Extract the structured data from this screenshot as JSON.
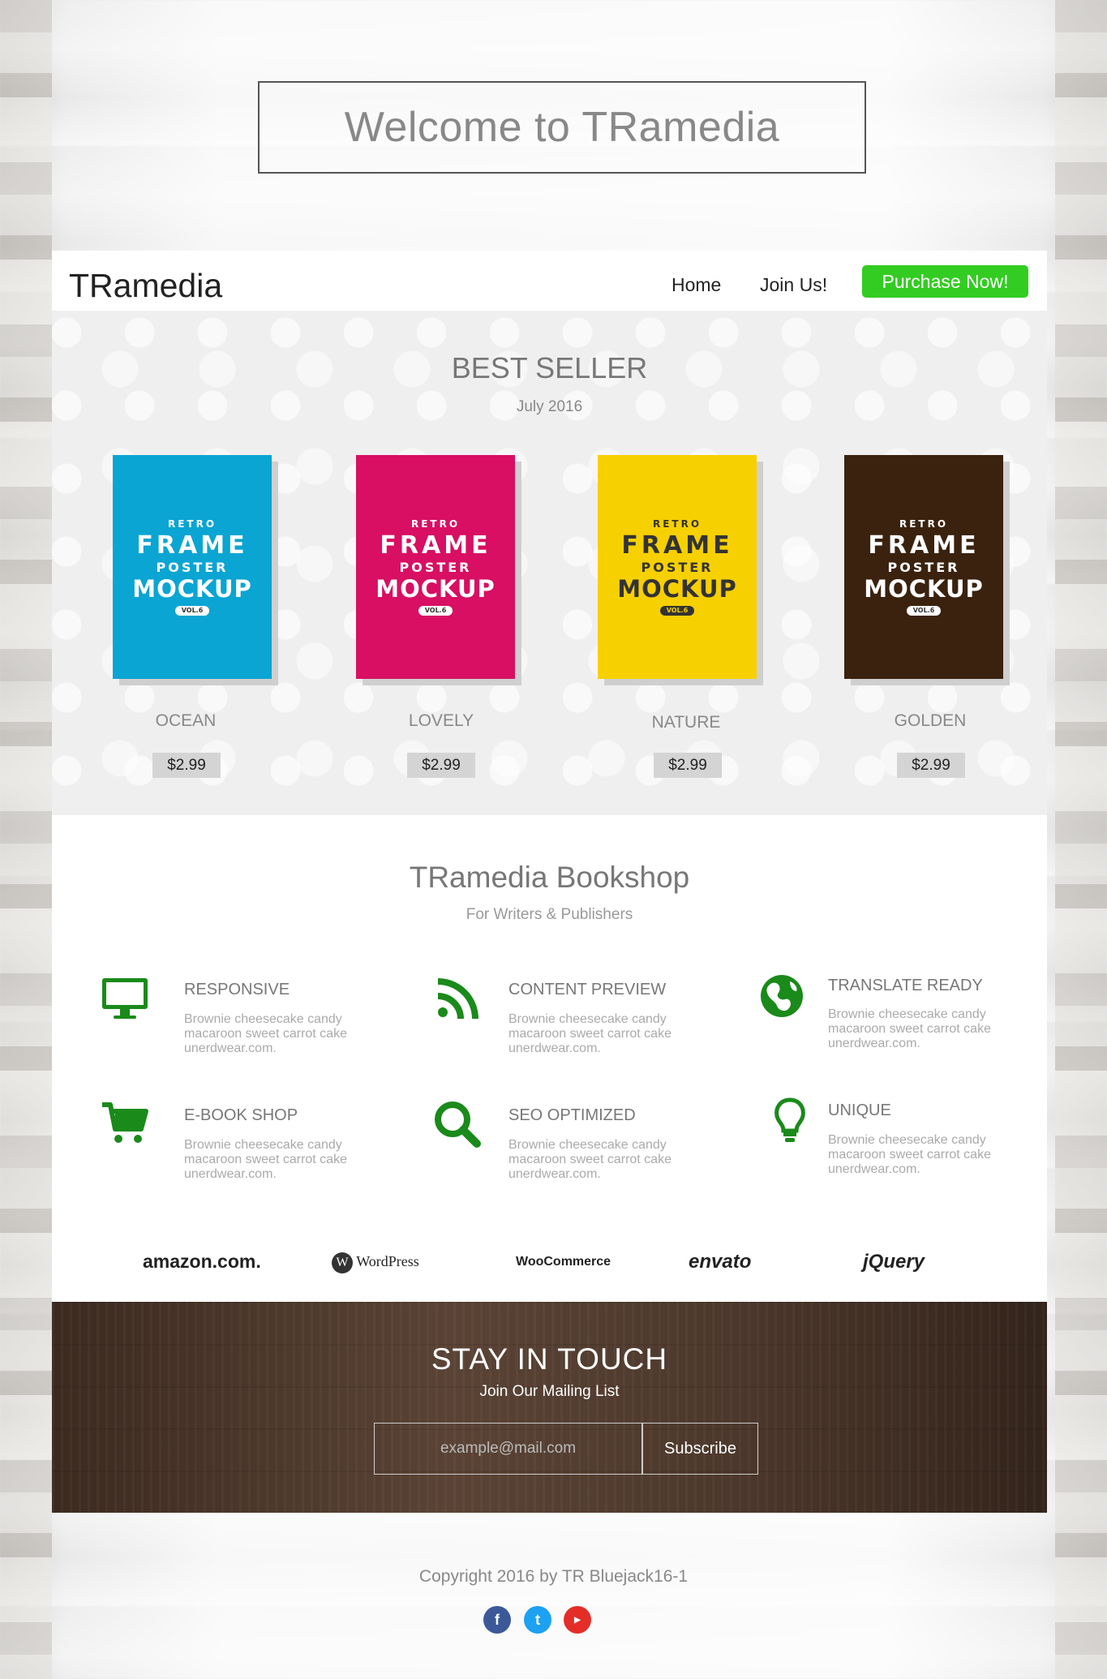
{
  "welcome": "Welcome to TRamedia",
  "header": {
    "logo": "TRamedia",
    "nav": {
      "home": "Home",
      "join": "Join Us!"
    },
    "purchase": "Purchase Now!"
  },
  "best_seller": {
    "title": "BEST SELLER",
    "subtitle": "July 2016",
    "products": [
      {
        "name": "OCEAN",
        "price": "$2.99",
        "color": "#0aa5d3"
      },
      {
        "name": "LOVELY",
        "price": "$2.99",
        "color": "#d80f63"
      },
      {
        "name": "NATURE",
        "price": "$2.99",
        "color": "#f7d000"
      },
      {
        "name": "GOLDEN",
        "price": "$2.99",
        "color": "#3a220e"
      }
    ],
    "poster": {
      "retro": "RETRO",
      "frame": "FRAME",
      "poster": "POSTER",
      "mockup": "MOCKUP",
      "vol": "VOL.6"
    }
  },
  "bookshop": {
    "title": "TRamedia Bookshop",
    "subtitle": "For Writers & Publishers",
    "features": [
      {
        "title": "RESPONSIVE",
        "icon": "monitor-icon",
        "desc": "Brownie cheesecake candy macaroon sweet carrot cake unerdwear.com."
      },
      {
        "title": "CONTENT PREVIEW",
        "icon": "rss-icon",
        "desc": "Brownie cheesecake candy macaroon sweet carrot cake unerdwear.com."
      },
      {
        "title": "TRANSLATE READY",
        "icon": "globe-icon",
        "desc": "Brownie cheesecake candy macaroon sweet carrot cake unerdwear.com."
      },
      {
        "title": "E-BOOK SHOP",
        "icon": "cart-icon",
        "desc": "Brownie cheesecake candy macaroon sweet carrot cake unerdwear.com."
      },
      {
        "title": "SEO OPTIMIZED",
        "icon": "search-icon",
        "desc": "Brownie cheesecake candy macaroon sweet carrot cake unerdwear.com."
      },
      {
        "title": "UNIQUE",
        "icon": "lightbulb-icon",
        "desc": "Brownie cheesecake candy macaroon sweet carrot cake unerdwear.com."
      }
    ],
    "icon_color": "#1a8a1a"
  },
  "brands": [
    "amazon.com.",
    "WordPress",
    "WooCommerce",
    "envato",
    "jQuery"
  ],
  "touch": {
    "title": "STAY IN TOUCH",
    "subtitle": "Join Our Mailing List",
    "email_placeholder": "example@mail.com",
    "subscribe": "Subscribe"
  },
  "footer": {
    "copyright": "Copyright 2016 by TR Bluejack16-1",
    "social": [
      {
        "name": "facebook-icon",
        "color": "#3b5998"
      },
      {
        "name": "twitter-icon",
        "color": "#1da1f2"
      },
      {
        "name": "youtube-icon",
        "color": "#e52d27"
      }
    ]
  }
}
